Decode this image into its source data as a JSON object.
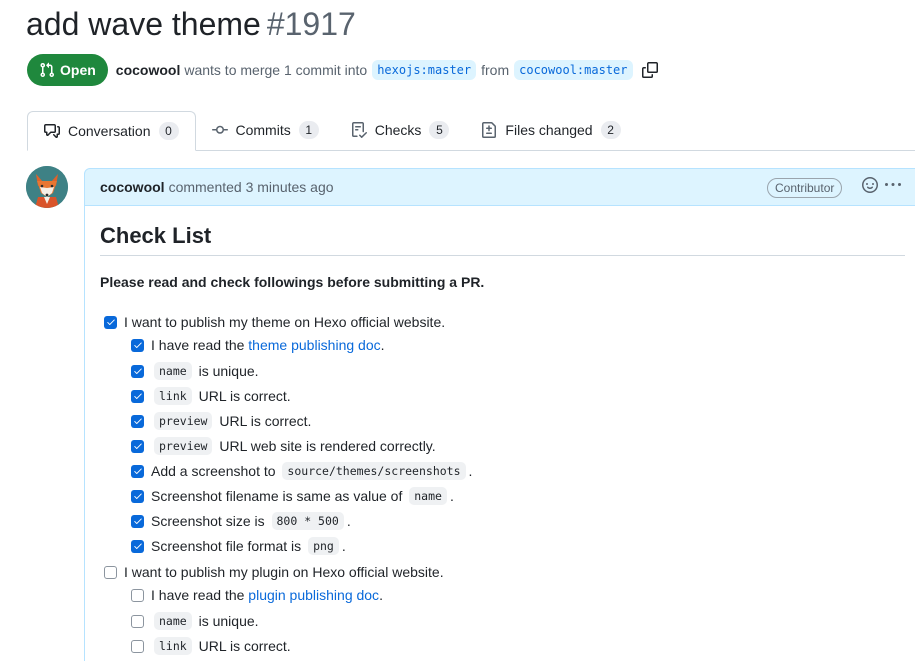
{
  "pr": {
    "title": "add wave theme",
    "number": "#1917",
    "state": "Open",
    "author": "cocowool",
    "merge_text": "wants to merge 1 commit into",
    "base_branch": "hexojs:master",
    "from_text": "from",
    "head_branch": "cocowool:master"
  },
  "tabs": [
    {
      "label": "Conversation",
      "count": "0",
      "icon": "comment-discussion-icon"
    },
    {
      "label": "Commits",
      "count": "1",
      "icon": "git-commit-icon"
    },
    {
      "label": "Checks",
      "count": "5",
      "icon": "checklist-icon"
    },
    {
      "label": "Files changed",
      "count": "2",
      "icon": "file-diff-icon"
    }
  ],
  "comment": {
    "author": "cocowool",
    "action": "commented 3 minutes ago",
    "badge": "Contributor",
    "heading": "Check List",
    "lead": "Please read and check followings before submitting a PR."
  },
  "checklist": {
    "theme": {
      "label": "I want to publish my theme on Hexo official website.",
      "checked": true,
      "items": {
        "read_pre": "I have read the",
        "read_link": "theme publishing doc",
        "read_post": ".",
        "name_code": "name",
        "name_post": "is unique.",
        "link_code": "link",
        "link_post": "URL is correct.",
        "preview_code": "preview",
        "preview_post": "URL is correct.",
        "preview2_code": "preview",
        "preview2_post": "URL web site is rendered correctly.",
        "shot_pre": "Add a screenshot to",
        "shot_code": "source/themes/screenshots",
        "shot_post": ".",
        "fname_pre": "Screenshot filename is same as value of",
        "fname_code": "name",
        "fname_post": ".",
        "size_pre": "Screenshot size is",
        "size_code": "800 * 500",
        "size_post": ".",
        "fmt_pre": "Screenshot file format is",
        "fmt_code": "png",
        "fmt_post": "."
      }
    },
    "plugin": {
      "label": "I want to publish my plugin on Hexo official website.",
      "checked": false,
      "items": {
        "read_pre": "I have read the",
        "read_link": "plugin publishing doc",
        "read_post": ".",
        "name_code": "name",
        "name_post": "is unique.",
        "link_code": "link",
        "link_post": "URL is correct."
      }
    }
  },
  "colors": {
    "open_green": "#1f883d",
    "link_blue": "#0969da",
    "header_bg": "#ddf4ff",
    "checkbox_blue": "#0969da"
  }
}
